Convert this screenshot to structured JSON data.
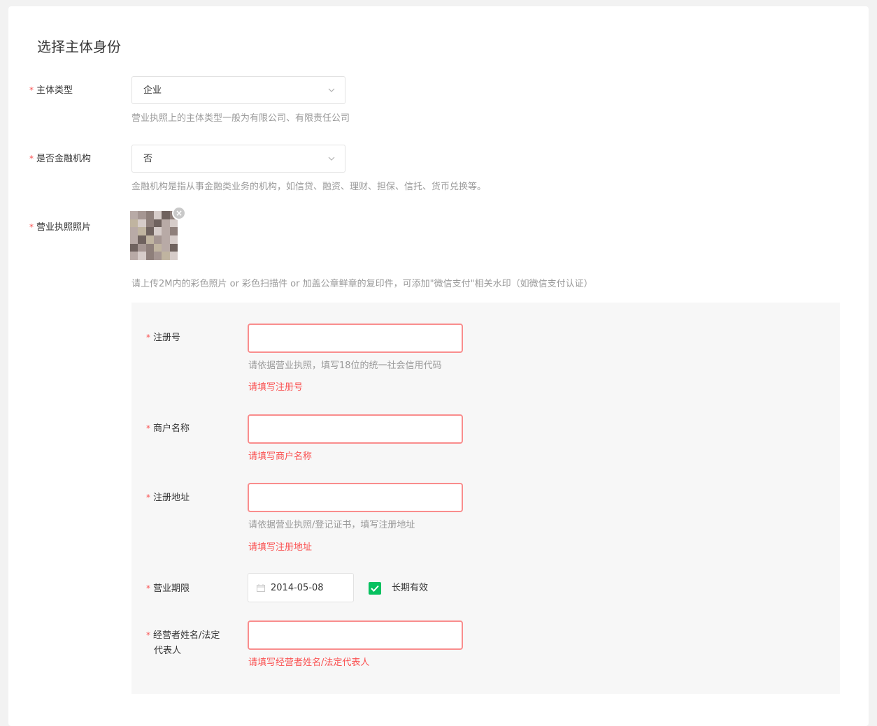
{
  "page": {
    "title": "选择主体身份"
  },
  "subject_type": {
    "label": "主体类型",
    "value": "企业",
    "hint": "营业执照上的主体类型一般为有限公司、有限责任公司"
  },
  "financial_institution": {
    "label": "是否金融机构",
    "value": "否",
    "hint": "金融机构是指从事金融类业务的机构，如信贷、融资、理财、担保、信托、货币兑换等。"
  },
  "license_photo": {
    "label": "营业执照照片",
    "hint": "请上传2M内的彩色照片 or 彩色扫描件 or 加盖公章鲜章的复印件，可添加\"微信支付\"相关水印（如微信支付认证）",
    "remove_symbol": "×"
  },
  "registration_number": {
    "label": "注册号",
    "value": "",
    "hint": "请依据营业执照，填写18位的统一社会信用代码",
    "error": "请填写注册号"
  },
  "merchant_name": {
    "label": "商户名称",
    "value": "",
    "error": "请填写商户名称"
  },
  "registered_address": {
    "label": "注册地址",
    "value": "",
    "hint": "请依据营业执照/登记证书，填写注册地址",
    "error": "请填写注册地址"
  },
  "business_term": {
    "label": "营业期限",
    "date": "2014-05-08",
    "long_term_label": "长期有效",
    "long_term_checked": true
  },
  "operator_name": {
    "label_line1": "经营者姓名/法定",
    "label_line2": "代表人",
    "value": "",
    "error": "请填写经营者姓名/法定代表人"
  },
  "colors": {
    "required": "#fa5151",
    "error_border": "#f98d8d",
    "checkbox": "#07c160",
    "panel_bg": "#f7f7f7"
  },
  "required_mark": "*"
}
